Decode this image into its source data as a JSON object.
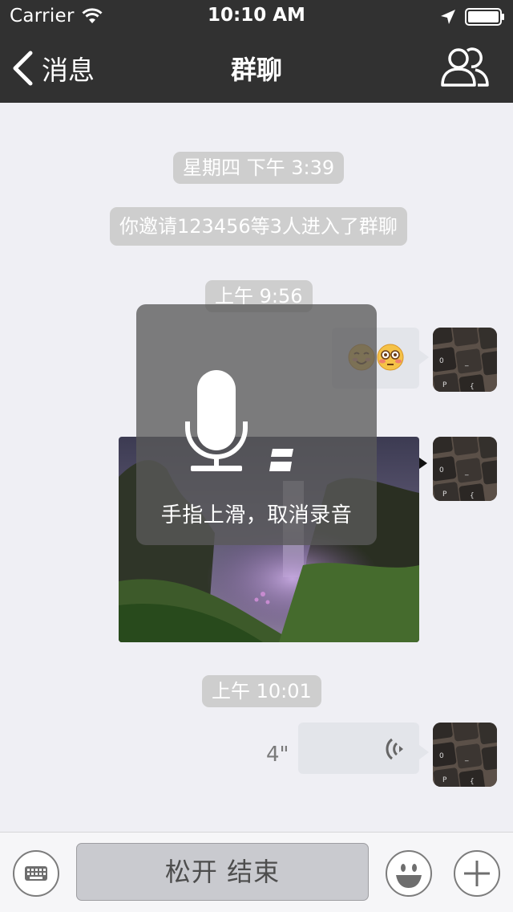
{
  "status_bar": {
    "carrier": "Carrier",
    "time": "10:10 AM"
  },
  "nav": {
    "back_label": "消息",
    "title": "群聊"
  },
  "messages": {
    "time_1": "星期四 下午 3:39",
    "system_notice": "你邀请123456等3人进入了群聊",
    "time_2": "上午 9:56",
    "time_3": "上午 10:01",
    "voice_duration": "4\""
  },
  "recording": {
    "tip": "手指上滑，取消录音"
  },
  "input_bar": {
    "hold_button": "松开 结束"
  },
  "icons": [
    "back-chevron-icon",
    "group-members-icon",
    "smiling-emoji-icon",
    "flushed-emoji-icon",
    "voice-playback-icon",
    "microphone-icon",
    "keyboard-icon",
    "emoji-icon",
    "plus-icon"
  ],
  "colors": {
    "nav_bg": "#313131",
    "chat_bg": "#efeff4",
    "bubble": "#e3e5ea",
    "pill": "#cecece"
  }
}
